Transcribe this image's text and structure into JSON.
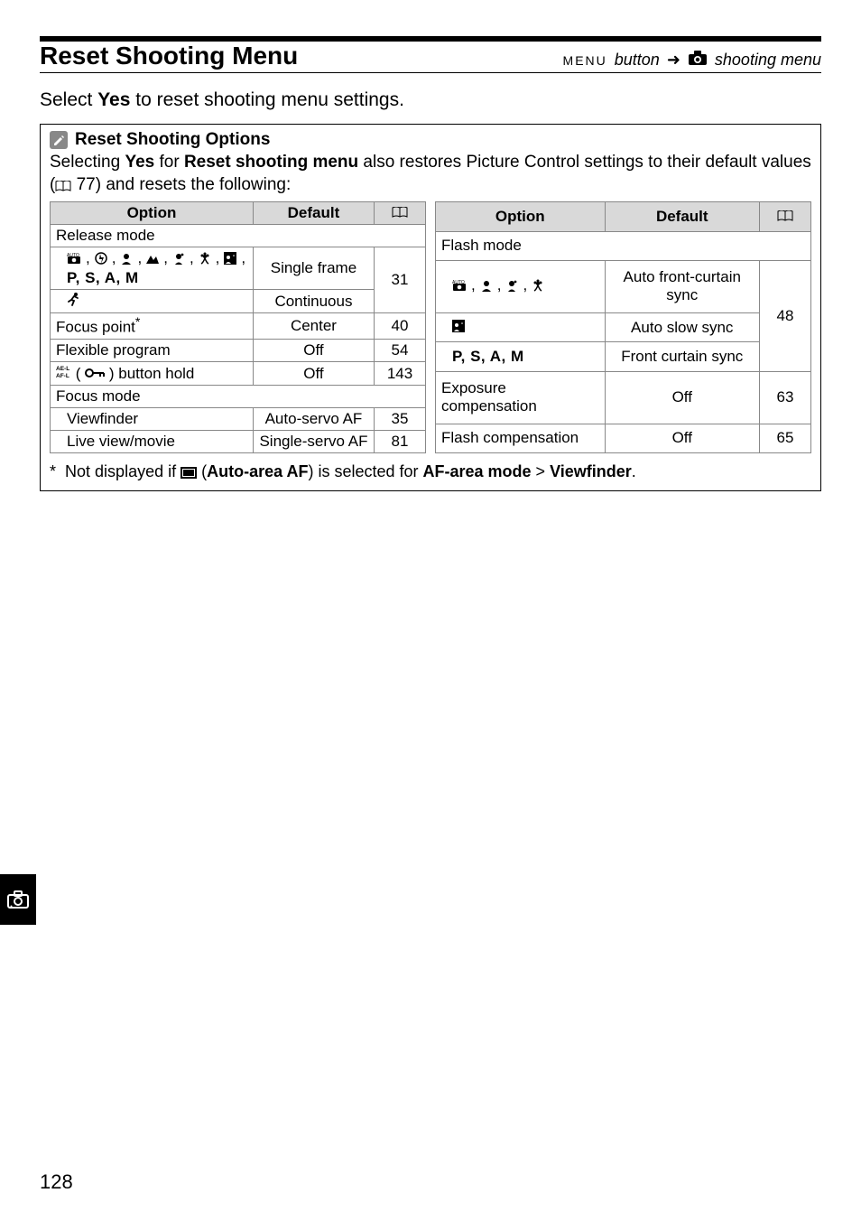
{
  "titlebar": {
    "left": "Reset Shooting Menu",
    "menu_glyph": "MENU",
    "button_text": "button",
    "arrow": "➜",
    "right_text": "shooting menu"
  },
  "body": {
    "select_text_pre": "Select ",
    "select_text_bold": "Yes",
    "select_text_post": " to reset shooting menu settings."
  },
  "box": {
    "title": "Reset Shooting Options",
    "desc_pre": "Selecting ",
    "desc_bold1": "Yes",
    "desc_mid1": " for ",
    "desc_bold2": "Reset shooting menu",
    "desc_mid2": " also restores Picture Control settings to their default values (",
    "desc_pageref": " 77) and resets the following:"
  },
  "headers": {
    "option": "Option",
    "default": "Default"
  },
  "left_table": {
    "section1": "Release mode",
    "row1_modes": "P, S, A, M",
    "row1_default": "Single frame",
    "row1_page": "31",
    "row2_default": "Continuous",
    "row3_option": "Focus point",
    "row3_sup": "*",
    "row3_default": "Center",
    "row3_page": "40",
    "row4_option": "Flexible program",
    "row4_default": "Off",
    "row4_page": "54",
    "row5_suffix": ") button hold",
    "row5_default": "Off",
    "row5_page": "143",
    "section2": "Focus mode",
    "row6_option": "Viewfinder",
    "row6_default": "Auto-servo AF",
    "row6_page": "35",
    "row7_option": "Live view/movie",
    "row7_default": "Single-servo AF",
    "row7_page": "81"
  },
  "right_table": {
    "section1": "Flash mode",
    "row1_default": "Auto front-curtain sync",
    "row1_page": "48",
    "row2_default": "Auto slow sync",
    "row3_option": "P, S, A, M",
    "row3_default": "Front curtain sync",
    "row4_option": "Exposure compensation",
    "row4_default": "Off",
    "row4_page": "63",
    "row5_option": "Flash compensation",
    "row5_default": "Off",
    "row5_page": "65"
  },
  "footnote": {
    "star": "*",
    "pre": "Not displayed if ",
    "mid1": " (",
    "bold1": "Auto-area AF",
    "mid2": ") is selected for ",
    "bold2": "AF-area mode",
    "gt": " > ",
    "bold3": "Viewfinder",
    "post": "."
  },
  "page_number": "128"
}
